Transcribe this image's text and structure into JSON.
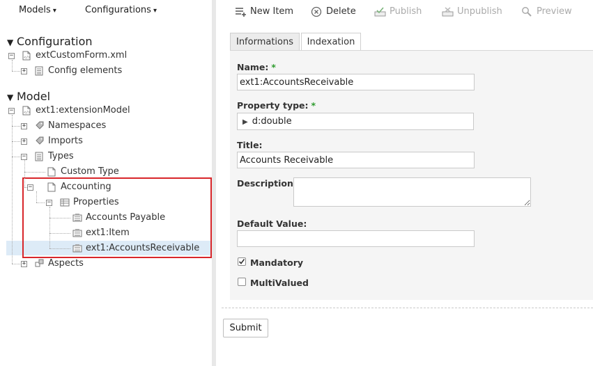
{
  "left_menu": {
    "models_label": "Models",
    "configurations_label": "Configurations",
    "caret": "▾"
  },
  "tree": {
    "configuration_header": "Configuration",
    "config_file": "extCustomForm.xml",
    "config_elements": "Config elements",
    "model_header": "Model",
    "model_name": "ext1:extensionModel",
    "namespaces": "Namespaces",
    "imports": "Imports",
    "types": "Types",
    "custom_type": "Custom Type",
    "accounting": "Accounting",
    "properties": "Properties",
    "accounts_payable": "Accounts Payable",
    "ext1_item": "ext1:Item",
    "ext1_accounts_receivable": "ext1:AccountsReceivable",
    "aspects": "Aspects"
  },
  "toolbar": {
    "new_item": "New Item",
    "delete": "Delete",
    "publish": "Publish",
    "unpublish": "Unpublish",
    "preview": "Preview"
  },
  "tabs": {
    "informations": "Informations",
    "indexation": "Indexation"
  },
  "form": {
    "name_label": "Name:",
    "name_value": "ext1:AccountsReceivable",
    "property_type_label": "Property type:",
    "property_type_value": "d:double",
    "title_label": "Title:",
    "title_value": "Accounts Receivable",
    "description_label": "Description:",
    "description_value": "",
    "default_value_label": "Default Value:",
    "default_value": "",
    "required_marker": "*",
    "mandatory_label": "Mandatory",
    "mandatory_checked": true,
    "multivalued_label": "MultiValued",
    "multivalued_checked": false,
    "submit_label": "Submit"
  },
  "colors": {
    "selection": "#ddebf7",
    "highlight_border": "#d8262a",
    "required_star": "#2e9c2e",
    "disabled_text": "#aaaaaa"
  }
}
